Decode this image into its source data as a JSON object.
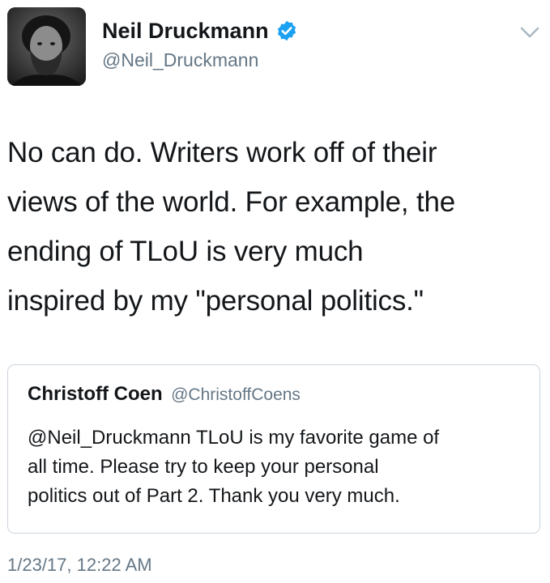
{
  "author": {
    "display_name": "Neil Druckmann",
    "handle": "@Neil_Druckmann",
    "verified": true,
    "avatar_icon": "profile-photo-icon",
    "verified_color": "#1da1f2"
  },
  "menu": {
    "icon": "chevron-down-icon"
  },
  "tweet": {
    "lines": [
      "No can do. Writers work off of their",
      "views of the world. For example, the",
      "ending of TLoU is very much",
      "inspired by my \"personal politics.\""
    ]
  },
  "quoted_tweet": {
    "display_name": "Christoff Coen",
    "handle": "@ChristoffCoens",
    "lines": [
      "@Neil_Druckmann TLoU is my favorite game of",
      "all time. Please try to keep your personal",
      "politics out of Part 2. Thank you very much."
    ]
  },
  "timestamp": "1/23/17, 12:22 AM",
  "colors": {
    "text": "#14171a",
    "secondary": "#657786",
    "border": "#ccd6dd"
  }
}
